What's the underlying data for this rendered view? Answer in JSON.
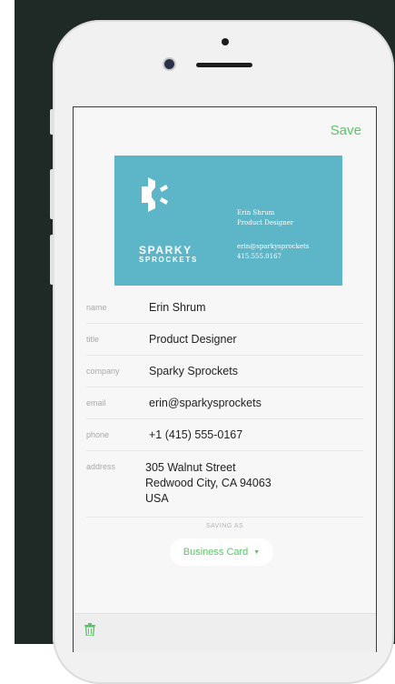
{
  "header": {
    "save_label": "Save"
  },
  "card": {
    "brand_line1": "SPARKY",
    "brand_line2": "SPROCKETS",
    "name": "Erin Shrum",
    "title": "Product Designer",
    "email": "erin@sparkysprockets",
    "phone": "415.555.0167",
    "background_color": "#5db5c8"
  },
  "fields": [
    {
      "label": "name",
      "value": "Erin Shrum"
    },
    {
      "label": "title",
      "value": "Product Designer"
    },
    {
      "label": "company",
      "value": "Sparky Sprockets"
    },
    {
      "label": "email",
      "value": "erin@sparkysprockets"
    },
    {
      "label": "phone",
      "value": "+1 (415) 555-0167"
    },
    {
      "label": "address",
      "lines": [
        "305 Walnut Street",
        "Redwood City, CA 94063",
        "USA"
      ]
    }
  ],
  "saving": {
    "label": "SAVING AS",
    "selected": "Business Card"
  },
  "icons": {
    "dropdown": "caret-down-icon",
    "delete": "trash-icon",
    "logo": "sprocket-logo-icon"
  },
  "colors": {
    "accent": "#5dc26a",
    "card": "#5db5c8"
  }
}
